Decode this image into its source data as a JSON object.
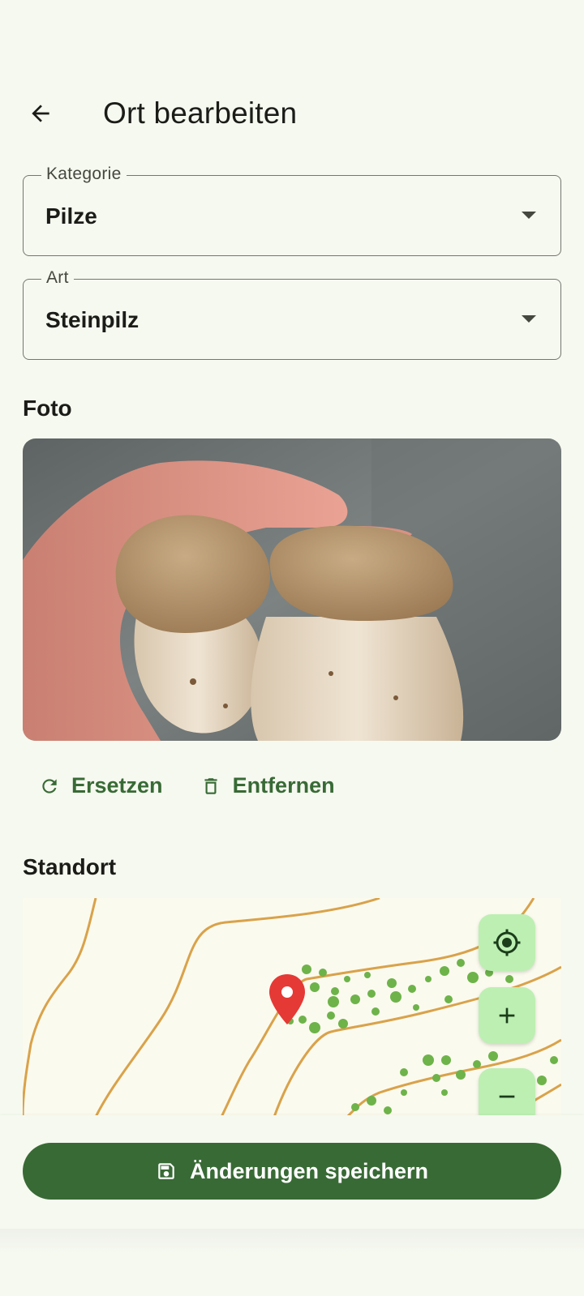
{
  "header": {
    "back_icon": "arrow-back-icon",
    "title": "Ort bearbeiten"
  },
  "form": {
    "kategorie": {
      "label": "Kategorie",
      "value": "Pilze"
    },
    "art": {
      "label": "Art",
      "value": "Steinpilz"
    }
  },
  "photo_section": {
    "title": "Foto",
    "image_subject": "two porcini mushrooms held in a hand",
    "replace_label": "Ersetzen",
    "replace_icon": "refresh-icon",
    "remove_label": "Entfernen",
    "remove_icon": "trash-icon"
  },
  "location_section": {
    "title": "Standort",
    "controls": {
      "locate_icon": "my-location-icon",
      "zoom_in_icon": "plus-icon",
      "zoom_out_icon": "minus-icon"
    },
    "marker_icon": "map-pin-icon"
  },
  "actions": {
    "save_label": "Änderungen speichern",
    "save_icon": "save-icon"
  },
  "colors": {
    "primary": "#386a35",
    "primary_container": "#bdefb3",
    "background": "#f6f9f0",
    "marker": "#e53935",
    "contour": "#d9a24a",
    "vegetation": "#6db34a"
  }
}
